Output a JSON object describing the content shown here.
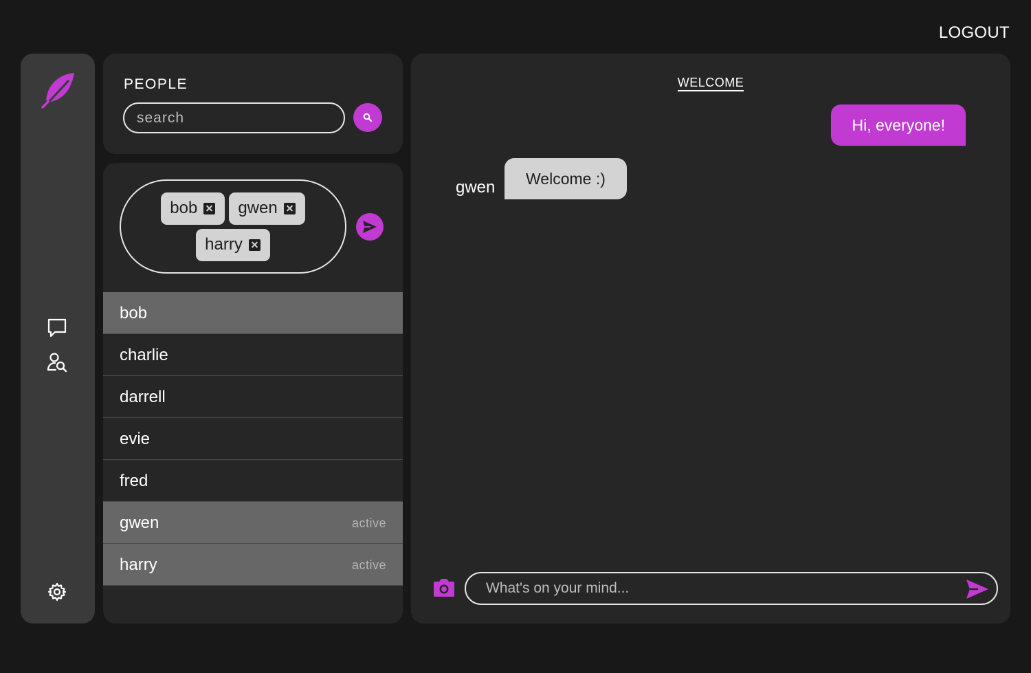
{
  "header": {
    "logout_label": "LOGOUT"
  },
  "sidebar": {
    "logo_icon": "feather-icon",
    "nav": [
      {
        "icon": "chat-bubble-icon"
      },
      {
        "icon": "user-search-icon"
      }
    ],
    "settings_icon": "gear-icon"
  },
  "people": {
    "title": "PEOPLE",
    "search": {
      "placeholder": "search",
      "value": ""
    },
    "recipients": [
      "bob",
      "gwen",
      "harry"
    ],
    "list": [
      {
        "name": "bob",
        "status": "",
        "selected": true
      },
      {
        "name": "charlie",
        "status": "",
        "selected": false
      },
      {
        "name": "darrell",
        "status": "",
        "selected": false
      },
      {
        "name": "evie",
        "status": "",
        "selected": false
      },
      {
        "name": "fred",
        "status": "",
        "selected": false
      },
      {
        "name": "gwen",
        "status": "active",
        "selected": true
      },
      {
        "name": "harry",
        "status": "active",
        "selected": true
      }
    ]
  },
  "chat": {
    "title": "WELCOME",
    "messages": [
      {
        "direction": "out",
        "sender": "",
        "text": "Hi, everyone!"
      },
      {
        "direction": "in",
        "sender": "gwen",
        "text": "Welcome :)"
      }
    ],
    "composer": {
      "placeholder": "What's on your mind...",
      "value": ""
    }
  },
  "colors": {
    "accent": "#c13ad1",
    "background": "#181818",
    "panel": "#262626",
    "sidebar": "#3a3a3a",
    "selected_row": "#676767",
    "bubble_in": "#d3d3d3"
  }
}
